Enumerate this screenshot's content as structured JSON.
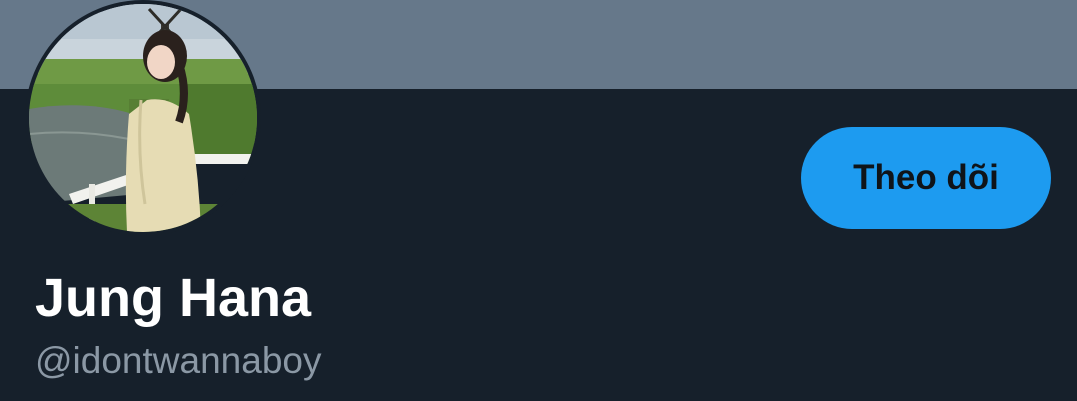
{
  "colors": {
    "banner": "#66788a",
    "background": "#16202b",
    "follow_button": "#1d9bf0",
    "follow_text": "#0f1419",
    "name": "#ffffff",
    "handle": "#8b98a5"
  },
  "profile": {
    "display_name": "Jung Hana",
    "handle": "@idontwannaboy",
    "avatar_icon": "profile-photo"
  },
  "actions": {
    "follow_label": "Theo dõi"
  }
}
